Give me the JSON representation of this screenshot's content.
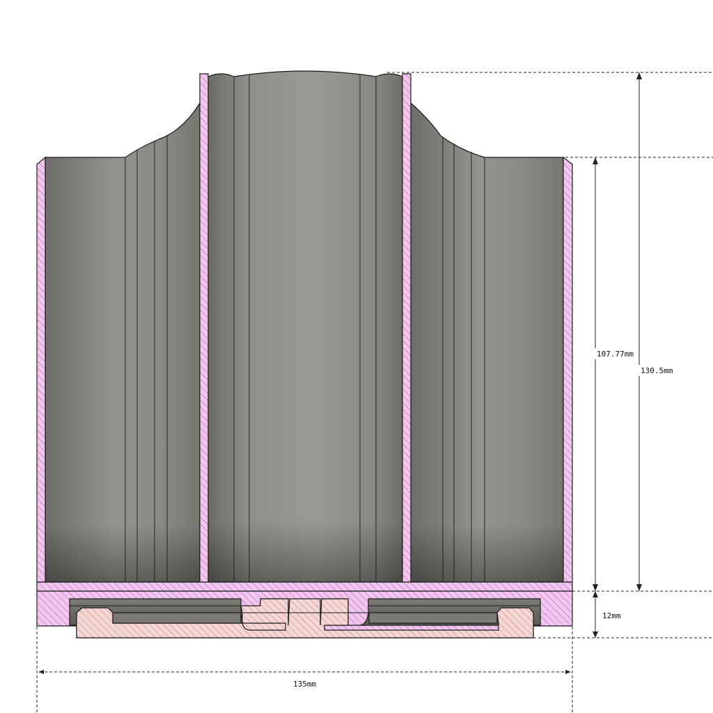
{
  "dimensions": {
    "inner_height": "107.77mm",
    "total_height": "130.5mm",
    "base_height": "12mm",
    "width": "135mm"
  },
  "colors": {
    "section_fill": "#f3c6ef",
    "section_hatch": "#9a5f96",
    "insert_fill": "#f4d6d4",
    "insert_hatch": "#b77a78",
    "body_gray": "#8b8a85",
    "outline": "#1a1a1a"
  }
}
